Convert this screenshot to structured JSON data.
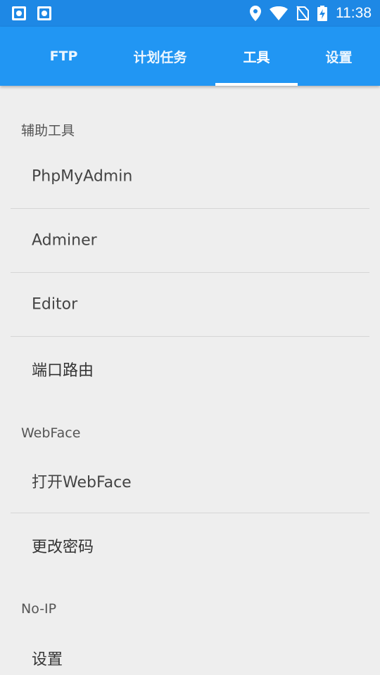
{
  "status_bar": {
    "time": "11:38",
    "icons": [
      "app-notification-icon",
      "app-notification-icon",
      "location-icon",
      "wifi-icon",
      "no-sim-icon",
      "battery-charging-icon"
    ]
  },
  "tabs": [
    {
      "label": "FTP",
      "active": false
    },
    {
      "label": "计划任务",
      "active": false
    },
    {
      "label": "工具",
      "active": true
    },
    {
      "label": "设置",
      "active": false
    }
  ],
  "colors": {
    "status_bar": "#1e88e5",
    "app_bar": "#2196f3",
    "background": "#eeeeee"
  },
  "sections": [
    {
      "header": "辅助工具",
      "items": [
        "PhpMyAdmin",
        "Adminer",
        "Editor",
        "端口路由"
      ]
    },
    {
      "header": "WebFace",
      "items": [
        "打开WebFace",
        "更改密码"
      ]
    },
    {
      "header": "No-IP",
      "items": [
        "设置"
      ]
    }
  ]
}
